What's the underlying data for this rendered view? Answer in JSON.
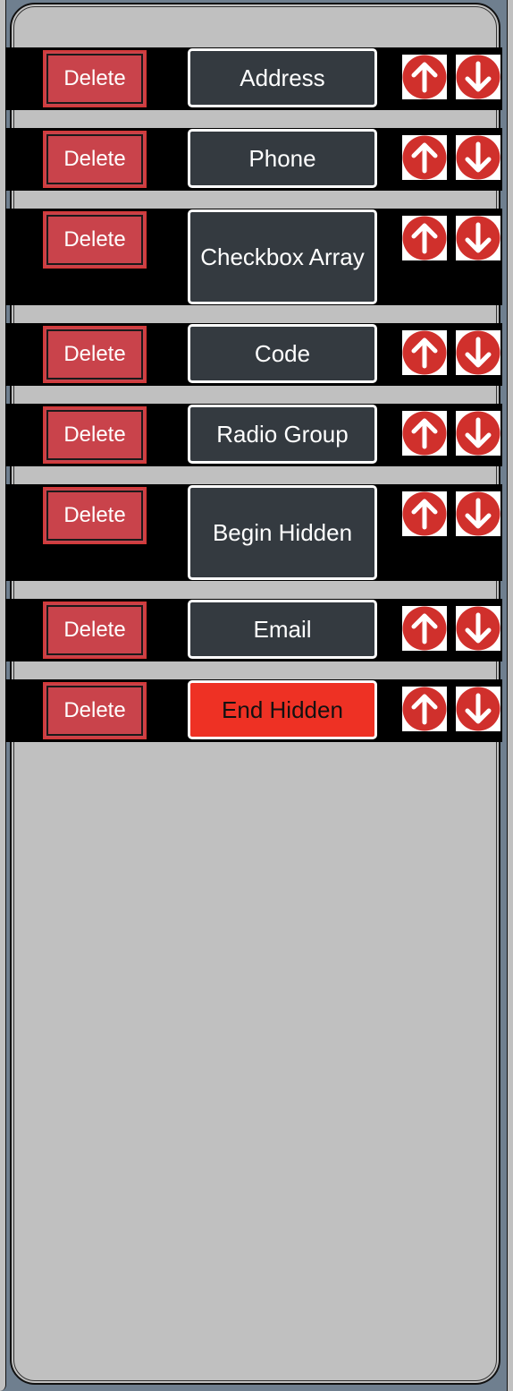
{
  "colors": {
    "background": "#6f7f8f",
    "panel": "#c0c0c0",
    "row": "#000000",
    "delete": "#c9434b",
    "field": "#343a40",
    "highlight": "#ee3124",
    "arrow": "#d0302c"
  },
  "rows": [
    {
      "delete_label": "Delete",
      "field_label": "Address",
      "highlight": false
    },
    {
      "delete_label": "Delete",
      "field_label": "Phone",
      "highlight": false
    },
    {
      "delete_label": "Delete",
      "field_label": "Checkbox Array",
      "highlight": false
    },
    {
      "delete_label": "Delete",
      "field_label": "Code",
      "highlight": false
    },
    {
      "delete_label": "Delete",
      "field_label": "Radio Group",
      "highlight": false
    },
    {
      "delete_label": "Delete",
      "field_label": "Begin Hidden",
      "highlight": false
    },
    {
      "delete_label": "Delete",
      "field_label": "Email",
      "highlight": false
    },
    {
      "delete_label": "Delete",
      "field_label": "End Hidden",
      "highlight": true
    }
  ],
  "icons": {
    "up": "arrow-up-circle-icon",
    "down": "arrow-down-circle-icon"
  }
}
